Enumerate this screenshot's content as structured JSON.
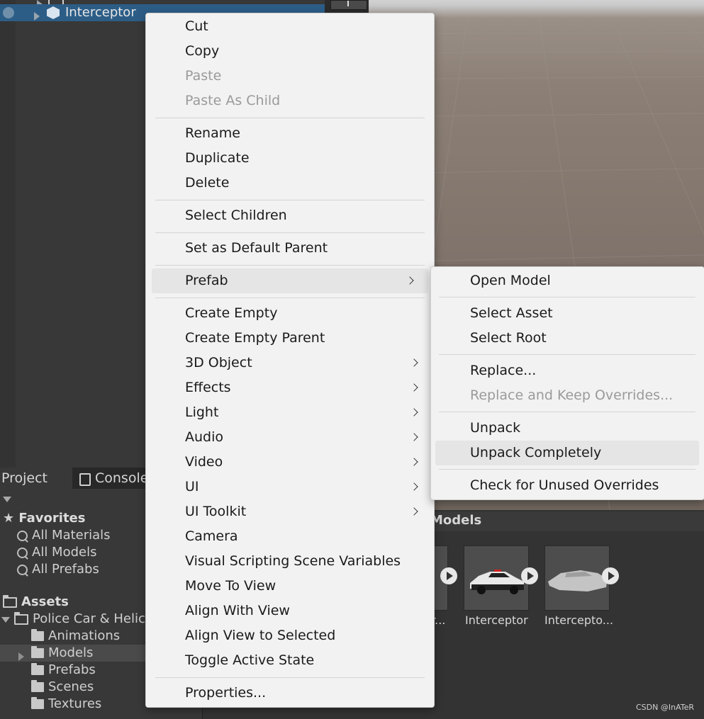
{
  "hierarchy": {
    "selected_item": "Interceptor"
  },
  "project": {
    "tabs": [
      "Project",
      "Console"
    ],
    "favorites": {
      "label": "Favorites",
      "items": [
        "All Materials",
        "All Models",
        "All Prefabs"
      ]
    },
    "assets": {
      "label": "Assets",
      "root_folder": "Police Car & Helic",
      "subfolders": [
        "Animations",
        "Models",
        "Prefabs",
        "Scenes",
        "Textures"
      ]
    },
    "breadcrumb_tail": "Models",
    "thumbnails": [
      {
        "label": "r..."
      },
      {
        "label": "Interceptor"
      },
      {
        "label": "Intercepto..."
      }
    ]
  },
  "context_menu": {
    "items": [
      {
        "label": "Cut"
      },
      {
        "label": "Copy"
      },
      {
        "label": "Paste"
      },
      {
        "label": "Paste As Child"
      },
      {
        "label": "Rename"
      },
      {
        "label": "Duplicate"
      },
      {
        "label": "Delete"
      },
      {
        "label": "Select Children"
      },
      {
        "label": "Set as Default Parent"
      },
      {
        "label": "Prefab"
      },
      {
        "label": "Create Empty"
      },
      {
        "label": "Create Empty Parent"
      },
      {
        "label": "3D Object"
      },
      {
        "label": "Effects"
      },
      {
        "label": "Light"
      },
      {
        "label": "Audio"
      },
      {
        "label": "Video"
      },
      {
        "label": "UI"
      },
      {
        "label": "UI Toolkit"
      },
      {
        "label": "Camera"
      },
      {
        "label": "Visual Scripting Scene Variables"
      },
      {
        "label": "Move To View"
      },
      {
        "label": "Align With View"
      },
      {
        "label": "Align View to Selected"
      },
      {
        "label": "Toggle Active State"
      },
      {
        "label": "Properties..."
      }
    ]
  },
  "prefab_submenu": {
    "items": [
      {
        "label": "Open Model"
      },
      {
        "label": "Select Asset"
      },
      {
        "label": "Select Root"
      },
      {
        "label": "Replace..."
      },
      {
        "label": "Replace and Keep Overrides..."
      },
      {
        "label": "Unpack"
      },
      {
        "label": "Unpack Completely"
      },
      {
        "label": "Check for Unused Overrides"
      }
    ]
  },
  "watermark": "CSDN @InATeR",
  "colors": {
    "menu_bg": "#f2f2f2",
    "menu_highlight": "#e5e5e5",
    "selection_blue": "#2c5d87",
    "editor_bg": "#383838"
  }
}
